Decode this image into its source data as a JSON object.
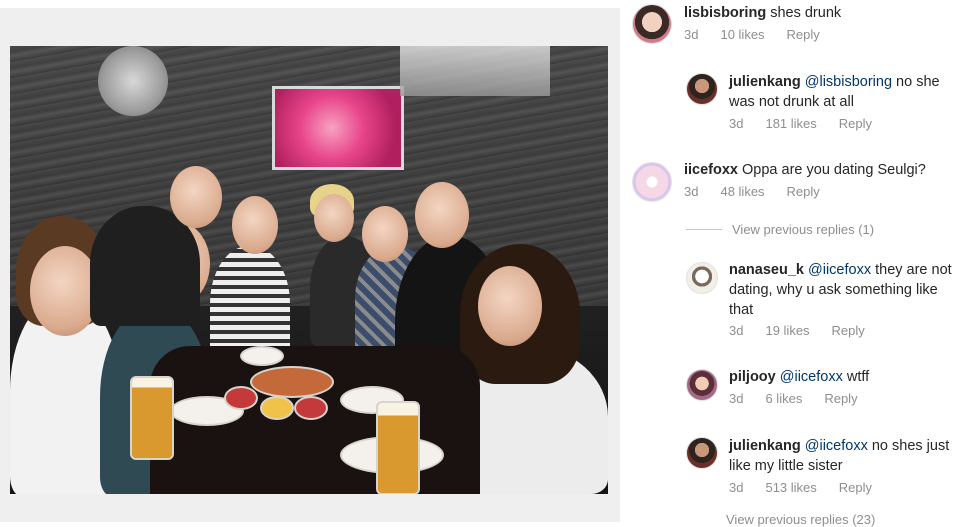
{
  "post": {
    "photo_alt": "group photo"
  },
  "comments": [
    {
      "username": "lisbisboring",
      "mention": "",
      "text": " shes drunk",
      "time": "3d",
      "likes": "10 likes",
      "reply": "Reply",
      "avatar": "woman-portrait-avatar"
    },
    {
      "username": "julienkang",
      "mention": "@lisbisboring",
      "text": " no she was not drunk at all",
      "time": "3d",
      "likes": "181 likes",
      "reply": "Reply",
      "avatar": "man-portrait-avatar"
    },
    {
      "username": "iicefoxx",
      "mention": "",
      "text": " Oppa are you dating Seulgi?",
      "time": "3d",
      "likes": "48 likes",
      "reply": "Reply",
      "avatar": "pastel-avatar"
    },
    {
      "username": "nanaseu_k",
      "mention": "@iicefoxx",
      "text": " they are not dating, why u ask something like that",
      "time": "3d",
      "likes": "19 likes",
      "reply": "Reply",
      "avatar": "sketch-avatar"
    },
    {
      "username": "piljooy",
      "mention": "@iicefoxx",
      "text": " wtff",
      "time": "3d",
      "likes": "6 likes",
      "reply": "Reply",
      "avatar": "girl-portrait-avatar"
    },
    {
      "username": "julienkang",
      "mention": "@iicefoxx",
      "text": " no shes just like my little sister",
      "time": "3d",
      "likes": "513 likes",
      "reply": "Reply",
      "avatar": "man-portrait-avatar"
    }
  ],
  "view_previous": "View previous replies (1)",
  "view_more_cut": "View previous replies (23)",
  "colors": {
    "username": "#262626",
    "mention": "#00376b",
    "meta": "#8e8e8e"
  }
}
